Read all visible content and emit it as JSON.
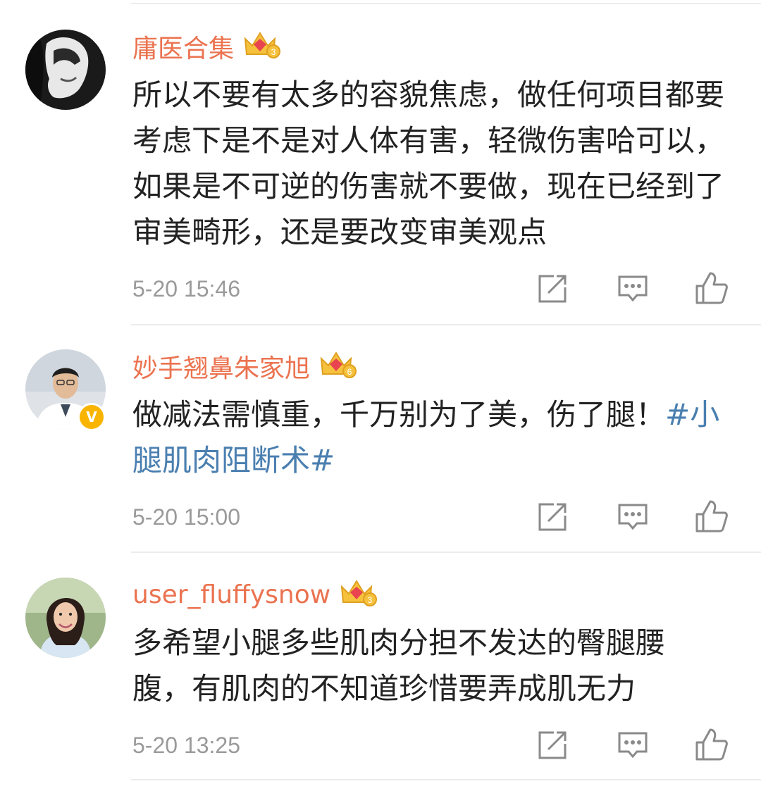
{
  "comments": [
    {
      "username": "庸医合集",
      "level": "3",
      "text": "所以不要有太多的容貌焦虑，做任何项目都要考虑下是不是对人体有害，轻微伤害哈可以，如果是不可逆的伤害就不要做，现在已经到了审美畸形，还是要改变审美观点",
      "hashtag": "",
      "time": "5-20 15:46"
    },
    {
      "username": "妙手翘鼻朱家旭",
      "level": "6",
      "verified_badge": "V",
      "text": "做减法需慎重，千万别为了美，伤了腿！",
      "hashtag": "#小腿肌肉阻断术#",
      "time": "5-20 15:00"
    },
    {
      "username": "user_fluffysnow",
      "level": "3",
      "text": "多希望小腿多些肌肉分担不发达的臀腿腰腹，有肌肉的不知道珍惜要弄成肌无力",
      "hashtag": "",
      "time": "5-20 13:25"
    }
  ],
  "icons": {
    "crown": "crown-level-icon",
    "repost": "repost-icon",
    "reply": "comment-icon",
    "like": "like-icon"
  },
  "colors": {
    "username": "#eb7350",
    "hashtag": "#4a7fb0",
    "text": "#222222",
    "timestamp": "#9a9a9a",
    "icon": "#8a8a8a",
    "verified": "#f9b400"
  }
}
